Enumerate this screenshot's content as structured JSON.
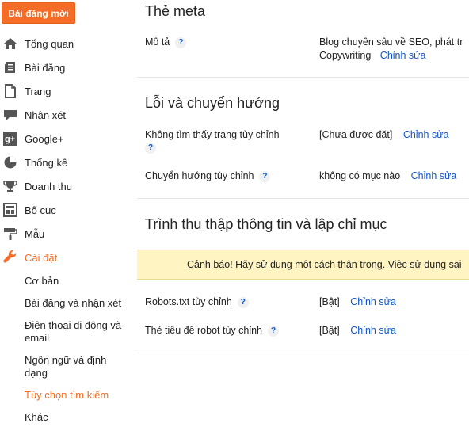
{
  "sidebar": {
    "new_post_label": "Bài đăng mới",
    "items": [
      {
        "label": "Tổng quan",
        "icon": "home-icon"
      },
      {
        "label": "Bài đăng",
        "icon": "posts-icon"
      },
      {
        "label": "Trang",
        "icon": "page-icon"
      },
      {
        "label": "Nhận xét",
        "icon": "comment-icon"
      },
      {
        "label": "Google+",
        "icon": "google-plus-icon"
      },
      {
        "label": "Thống kê",
        "icon": "stats-icon"
      },
      {
        "label": "Doanh thu",
        "icon": "trophy-icon"
      },
      {
        "label": "Bố cục",
        "icon": "layout-icon"
      },
      {
        "label": "Mẫu",
        "icon": "paint-roller-icon"
      },
      {
        "label": "Cài đặt",
        "icon": "wrench-icon"
      }
    ],
    "subitems": [
      {
        "label": "Cơ bản"
      },
      {
        "label": "Bài đăng và nhận xét"
      },
      {
        "label": "Điện thoại di động và email"
      },
      {
        "label": "Ngôn ngữ và định dạng"
      },
      {
        "label": "Tùy chọn tìm kiếm"
      },
      {
        "label": "Khác"
      }
    ],
    "accent_color": "#f46c25"
  },
  "main": {
    "meta": {
      "title": "Thẻ meta",
      "desc_label": "Mô tả",
      "desc_value_line1": "Blog chuyên sâu về SEO, phát tr",
      "desc_value_line2": "Copywriting",
      "edit_label": "Chỉnh sửa"
    },
    "errors": {
      "title": "Lỗi và chuyển hướng",
      "notfound_label": "Không tìm thấy trang tùy chỉnh",
      "notfound_value": "[Chưa được đặt]",
      "redirect_label": "Chuyển hướng tùy chỉnh",
      "redirect_value": "không có mục nào",
      "edit_label": "Chỉnh sửa"
    },
    "crawl": {
      "title": "Trình thu thập thông tin và lập chỉ mục",
      "warning": "Cảnh báo! Hãy sử dụng một cách thận trọng. Việc sử dụng sai",
      "robots_label": "Robots.txt tùy chỉnh",
      "robots_value": "[Bật]",
      "header_label": "Thẻ tiêu đề robot tùy chỉnh",
      "header_value": "[Bật]",
      "edit_label": "Chỉnh sửa"
    },
    "help_glyph": "?"
  }
}
